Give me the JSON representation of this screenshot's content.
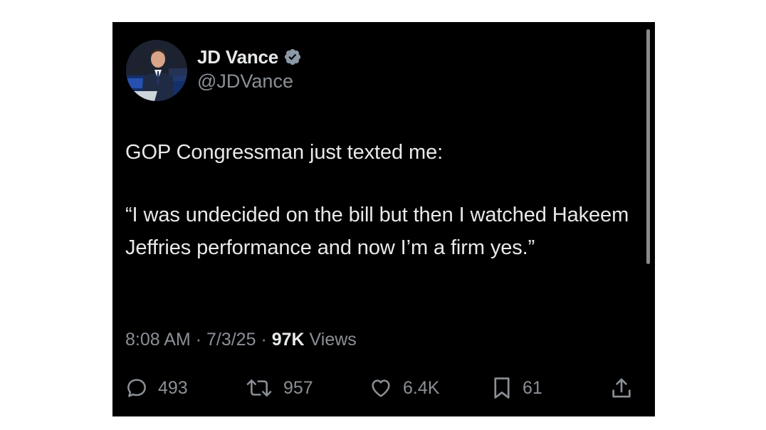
{
  "user": {
    "display_name": "JD Vance",
    "handle": "@JDVance",
    "verified": true
  },
  "tweet": {
    "paragraphs": [
      "GOP Congressman just texted me:",
      "“I was undecided on the bill but then I watched Hakeem Jeffries performance and now I’m a firm yes.”"
    ]
  },
  "meta": {
    "time": "8:08 AM",
    "separator": "·",
    "date": "7/3/25",
    "views_count": "97K",
    "views_label": "Views"
  },
  "actions": {
    "replies": "493",
    "reposts": "957",
    "likes": "6.4K",
    "bookmarks": "61"
  },
  "colors": {
    "background": "#000000",
    "text_primary": "#e7e9ea",
    "text_secondary": "#8b9096",
    "verified_badge": "#8b98a5"
  },
  "icons": [
    "verified-badge-icon",
    "reply-icon",
    "repost-icon",
    "like-icon",
    "bookmark-icon",
    "share-icon"
  ]
}
